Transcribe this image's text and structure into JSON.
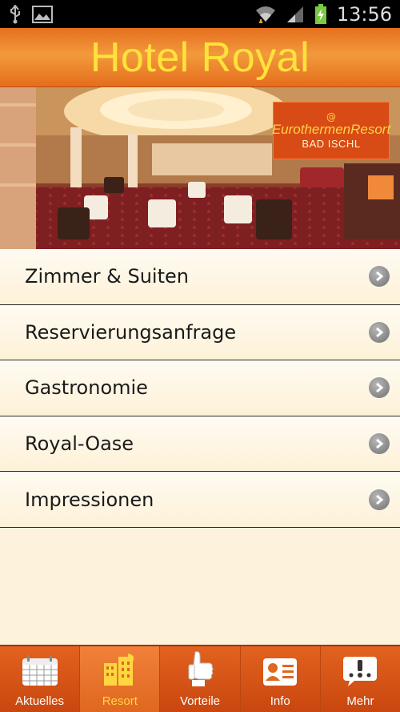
{
  "status_bar": {
    "time": "13:56",
    "icons": [
      "usb-icon",
      "image-icon",
      "wifi-icon",
      "signal-icon",
      "battery-charging-icon"
    ]
  },
  "header": {
    "title": "Hotel Royal"
  },
  "hero": {
    "logo_brand": "EurothermenResort",
    "logo_sub": "BAD ISCHL"
  },
  "menu": {
    "items": [
      {
        "label": "Zimmer & Suiten"
      },
      {
        "label": "Reservierungsanfrage"
      },
      {
        "label": "Gastronomie"
      },
      {
        "label": "Royal-Oase"
      },
      {
        "label": "Impressionen"
      }
    ]
  },
  "bottom_nav": {
    "items": [
      {
        "label": "Aktuelles",
        "icon": "calendar-icon",
        "active": false
      },
      {
        "label": "Resort",
        "icon": "buildings-icon",
        "active": true
      },
      {
        "label": "Vorteile",
        "icon": "thumbs-up-icon",
        "active": false
      },
      {
        "label": "Info",
        "icon": "contact-card-icon",
        "active": false
      },
      {
        "label": "Mehr",
        "icon": "more-icon",
        "active": false
      }
    ]
  },
  "colors": {
    "header_orange": "#e66f1e",
    "title_yellow": "#ffe23a",
    "nav_orange": "#d8541a",
    "active_yellow": "#ffd640",
    "menu_bg": "#fdf3dc"
  }
}
